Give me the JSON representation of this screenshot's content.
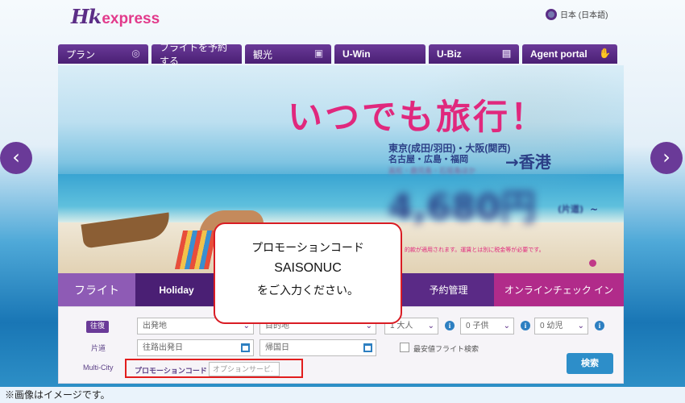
{
  "header": {
    "logo_hk": "Hk",
    "logo_express": "express",
    "language": "日本 (日本語)"
  },
  "nav": [
    {
      "label": "プラン",
      "icon": "compass-icon"
    },
    {
      "label": "フライトを予約する",
      "icon": ""
    },
    {
      "label": "観光",
      "icon": "camera-icon"
    },
    {
      "label": "U-Win",
      "icon": ""
    },
    {
      "label": "U-Biz",
      "icon": "briefcase-icon"
    },
    {
      "label": "Agent portal",
      "icon": "handshake-icon"
    }
  ],
  "hero": {
    "headline": "いつでも旅行！",
    "route_line1": "東京(成田/羽田)・大阪(関西)",
    "route_line2": "名古屋・広島・福岡",
    "route_line3": "高松・鹿児島・石垣島ほか",
    "destination": "→香港",
    "price": "4,680円",
    "price_suffix": "(片道)",
    "price_tilde": "~",
    "fine_print": "的款が適用されます。運賃とは別に税金等が必要です。"
  },
  "slider": {
    "prev": "‹",
    "next": "›"
  },
  "booking": {
    "tabs": [
      {
        "label": "フライト"
      },
      {
        "label": "Holiday"
      },
      {
        "label": ""
      },
      {
        "label": "予約管理"
      },
      {
        "label": "オンラインチェック イン"
      }
    ],
    "trip_types": [
      "往復",
      "片道",
      "Multi-City"
    ],
    "origin_placeholder": "出発地",
    "destination_placeholder": "目的地",
    "depart_date_placeholder": "往路出発日",
    "return_date_placeholder": "帰国日",
    "adults": "1 大人",
    "children": "0 子供",
    "infants": "0 幼児",
    "lowest_fare_label": "最安値フライト検索",
    "promo_label": "プロモーションコード",
    "promo_placeholder": "オプションサービ.",
    "search_button": "検索"
  },
  "callout": {
    "line1": "プロモーションコード",
    "line2": "SAISONUC",
    "line3": "をご入力ください。"
  },
  "caption": "※画像はイメージです。",
  "colors": {
    "brand_purple": "#5b2d86",
    "brand_pink": "#e0287d",
    "highlight_red": "#e21d1d",
    "button_blue": "#2d8ec9"
  }
}
